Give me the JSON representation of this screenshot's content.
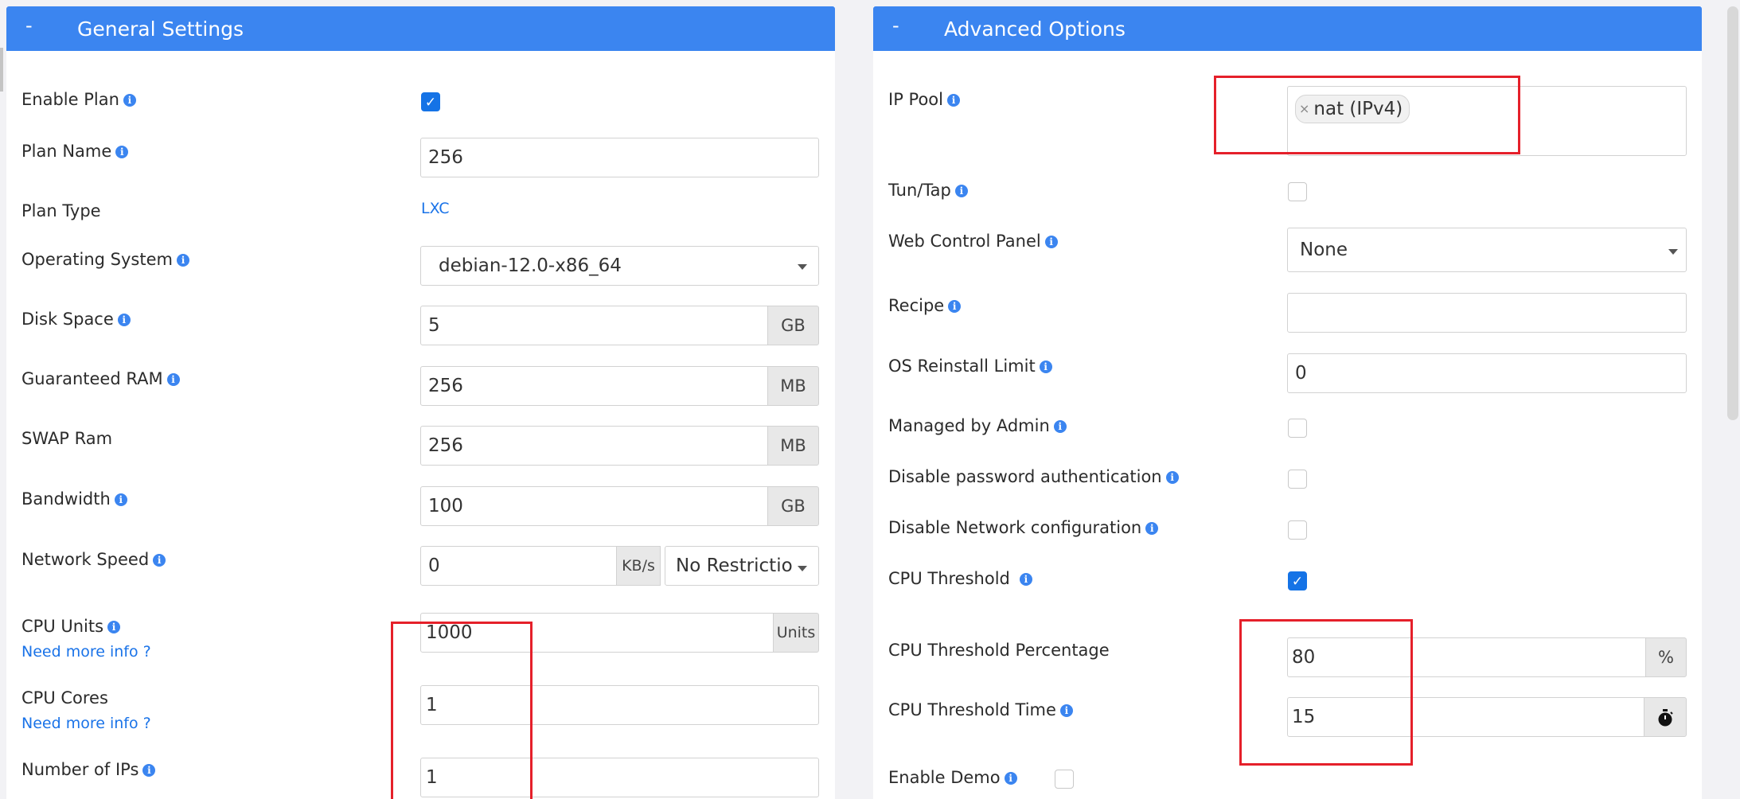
{
  "general": {
    "toggle": "-",
    "title": "General Settings",
    "rows": {
      "enable_plan": {
        "label": "Enable Plan",
        "checked": true
      },
      "plan_name": {
        "label": "Plan Name",
        "value": "256"
      },
      "plan_type": {
        "label": "Plan Type",
        "value": "LXC"
      },
      "os": {
        "label": "Operating System",
        "value": "debian-12.0-x86_64"
      },
      "disk": {
        "label": "Disk Space",
        "value": "5",
        "unit": "GB"
      },
      "ram": {
        "label": "Guaranteed RAM",
        "value": "256",
        "unit": "MB"
      },
      "swap": {
        "label": "SWAP Ram",
        "value": "256",
        "unit": "MB"
      },
      "bandwidth": {
        "label": "Bandwidth",
        "value": "100",
        "unit": "GB"
      },
      "net_speed": {
        "label": "Network Speed",
        "value": "0",
        "unit": "KB/s",
        "select": "No Restrictio"
      },
      "cpu_units": {
        "label": "CPU Units",
        "link": "Need more info ?",
        "value": "1000",
        "unit": "Units"
      },
      "cpu_cores": {
        "label": "CPU Cores",
        "link": "Need more info ?",
        "value": "1"
      },
      "num_ips": {
        "label": "Number of IPs",
        "value": "1"
      }
    }
  },
  "advanced": {
    "toggle": "-",
    "title": "Advanced Options",
    "rows": {
      "ip_pool": {
        "label": "IP Pool",
        "chip": "nat (IPv4)",
        "chip_remove": "×"
      },
      "tun_tap": {
        "label": "Tun/Tap",
        "checked": false
      },
      "web_panel": {
        "label": "Web Control Panel",
        "value": "None"
      },
      "recipe": {
        "label": "Recipe",
        "value": ""
      },
      "os_reinstall": {
        "label": "OS Reinstall Limit",
        "value": "0"
      },
      "managed_admin": {
        "label": "Managed by Admin",
        "checked": false
      },
      "disable_pw": {
        "label": "Disable password authentication",
        "checked": false
      },
      "disable_net": {
        "label": "Disable Network configuration",
        "checked": false
      },
      "cpu_threshold": {
        "label": "CPU Threshold",
        "checked": true
      },
      "cpu_threshold_pct": {
        "label": "CPU Threshold Percentage",
        "value": "80",
        "unit": "%"
      },
      "cpu_threshold_time": {
        "label": "CPU Threshold Time",
        "value": "15",
        "unit_icon": "stopwatch-icon"
      },
      "enable_demo": {
        "label": "Enable Demo",
        "checked": false
      }
    }
  },
  "colors": {
    "accent": "#3b85f0",
    "checkbox": "#1573e6",
    "highlight": "#e5202a",
    "link": "#1a73e8"
  }
}
